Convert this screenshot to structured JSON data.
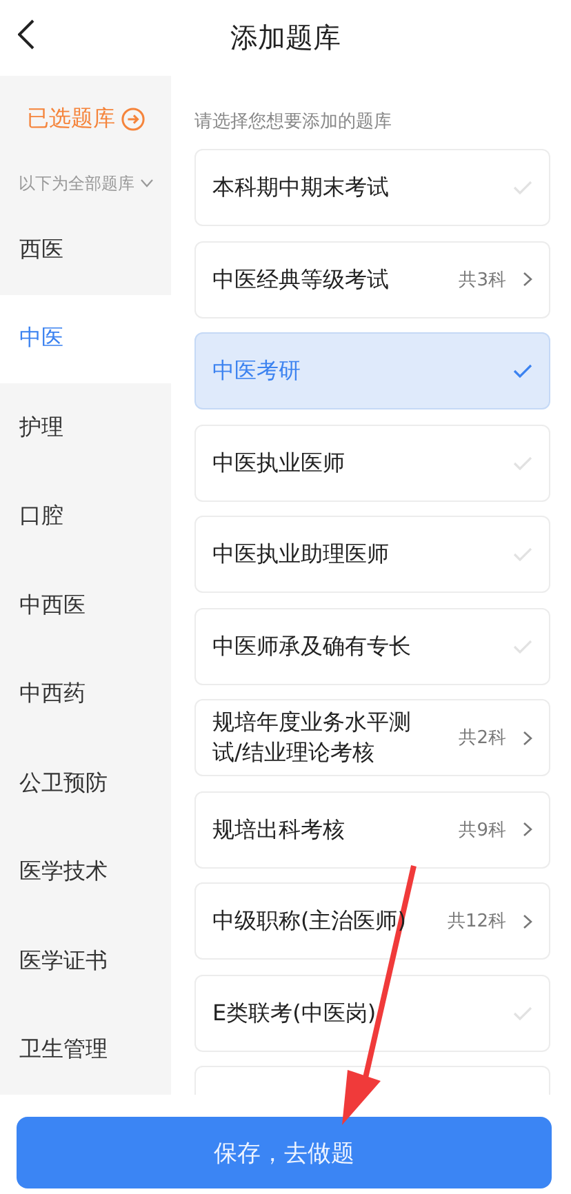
{
  "header": {
    "title": "添加题库"
  },
  "sidebar": {
    "selected_link": "已选题库",
    "filter_label": "以下为全部题库",
    "items": [
      {
        "label": "西医",
        "selected": false
      },
      {
        "label": "中医",
        "selected": true
      },
      {
        "label": "护理",
        "selected": false
      },
      {
        "label": "口腔",
        "selected": false
      },
      {
        "label": "中西医",
        "selected": false
      },
      {
        "label": "中西药",
        "selected": false
      },
      {
        "label": "公卫预防",
        "selected": false
      },
      {
        "label": "医学技术",
        "selected": false
      },
      {
        "label": "医学证书",
        "selected": false
      },
      {
        "label": "卫生管理",
        "selected": false
      }
    ]
  },
  "list": {
    "hint": "请选择您想要添加的题库",
    "items": [
      {
        "kind": "exam",
        "name": "本科期中期末考试",
        "selected": false
      },
      {
        "kind": "group",
        "name": "中医经典等级考试",
        "count": "共3科"
      },
      {
        "kind": "exam",
        "name": "中医考研",
        "selected": true
      },
      {
        "kind": "exam",
        "name": "中医执业医师",
        "selected": false
      },
      {
        "kind": "exam",
        "name": "中医执业助理医师",
        "selected": false
      },
      {
        "kind": "exam",
        "name": "中医师承及确有专长",
        "selected": false
      },
      {
        "kind": "group",
        "name": "规培年度业务水平测试/结业理论考核",
        "count": "共2科"
      },
      {
        "kind": "group",
        "name": "规培出科考核",
        "count": "共9科"
      },
      {
        "kind": "group",
        "name": "中级职称(主治医师)",
        "count": "共12科"
      },
      {
        "kind": "exam",
        "name": "E类联考(中医岗)",
        "selected": false
      },
      {
        "kind": "partial"
      }
    ]
  },
  "footer": {
    "button": "保存，去做题"
  }
}
